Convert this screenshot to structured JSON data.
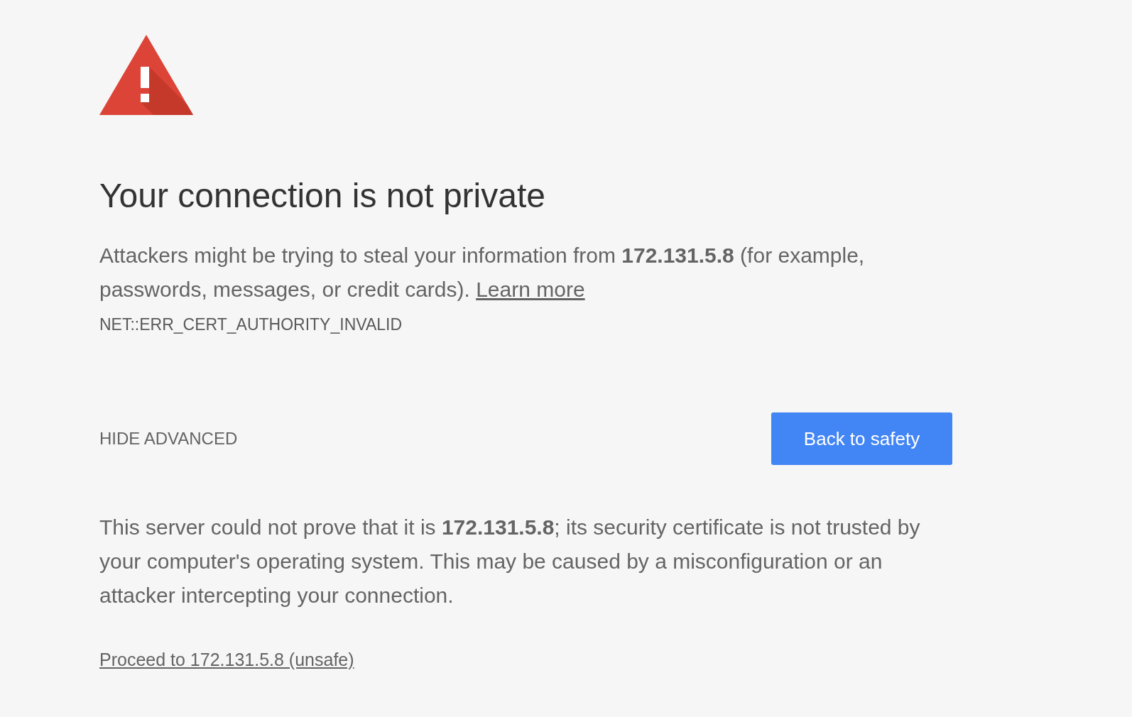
{
  "heading": "Your connection is not private",
  "summary": {
    "text": "Attackers might be trying to steal your information from **172.131.5.8** (for example, passwords, messages, or credit cards).",
    "link": "Learn more"
  },
  "error_code": "NET::ERR_CERT_AUTHORITY_INVALID",
  "advanced_toggle": "HIDE ADVANCED",
  "primary_button": "Back to safety",
  "details": "This server could not prove that it is **172.131.5.8**; its security certificate is not trusted by your computer's operating system. This may be caused by a misconfiguration or an attacker intercepting your connection.",
  "proceed_link": "Proceed to 172.131.5.8 (unsafe)"
}
